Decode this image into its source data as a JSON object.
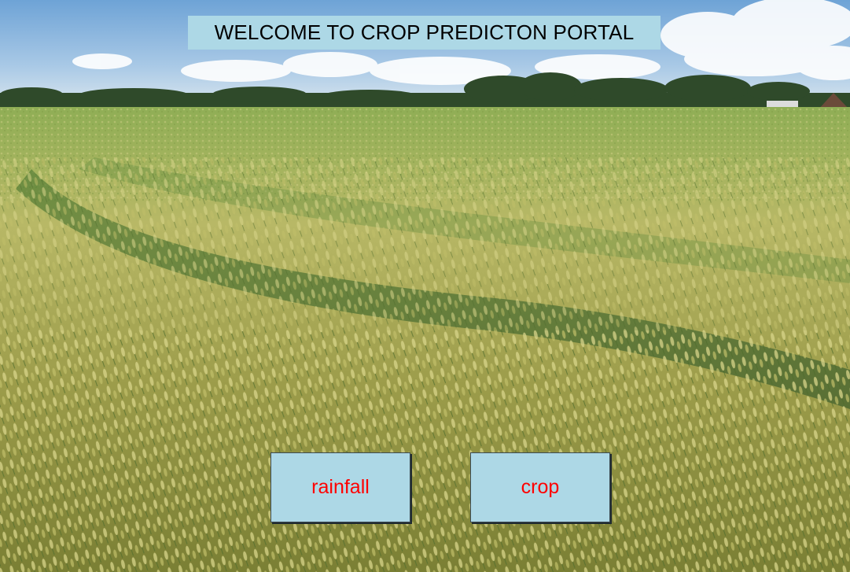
{
  "window": {
    "title": "WELCOME TO CROP PREDICTON PORTAL"
  },
  "buttons": {
    "rainfall_label": "rainfall",
    "crop_label": "crop"
  },
  "background": {
    "subject": "wheat field under blue sky with clouds"
  },
  "colors": {
    "banner_bg": "#add8e6",
    "button_bg": "#add8e6",
    "button_text": "#ff0000",
    "title_text": "#000000"
  }
}
